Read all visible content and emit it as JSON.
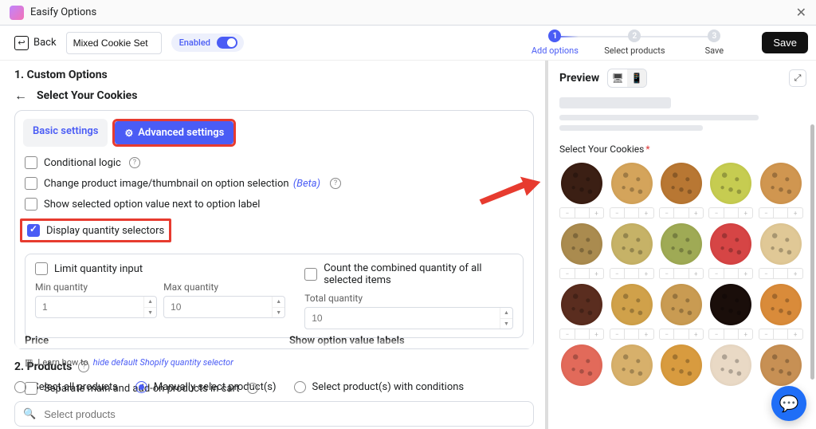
{
  "titlebar": {
    "title": "Easify Options"
  },
  "topbar": {
    "back_label": "Back",
    "title_value": "Mixed Cookie Set",
    "enabled_label": "Enabled",
    "save_label": "Save"
  },
  "stepper": {
    "step1": {
      "num": "1",
      "label": "Add options"
    },
    "step2": {
      "num": "2",
      "label": "Select products"
    },
    "step3": {
      "num": "3",
      "label": "Save"
    }
  },
  "headings": {
    "custom_options": "1. Custom Options",
    "select_cookies": "Select Your Cookies",
    "products": "2. Products"
  },
  "tabs": {
    "basic": "Basic settings",
    "advanced": "Advanced settings"
  },
  "options": {
    "conditional": "Conditional logic",
    "change_image": "Change product image/thumbnail on option selection",
    "beta_tag": "(Beta)",
    "show_selected_value": "Show selected option value next to option label",
    "display_qty": "Display quantity selectors",
    "limit_qty": "Limit quantity input",
    "count_combined": "Count the combined quantity of all selected items",
    "min_qty_label": "Min quantity",
    "max_qty_label": "Max quantity",
    "total_qty_label": "Total quantity",
    "min_qty_ph": "1",
    "max_qty_ph": "10",
    "total_qty_ph": "10",
    "learn_prefix": "Learn how to ",
    "learn_link": "hide default Shopify quantity selector",
    "separate_main": "Separate main and add-on products in cart",
    "price_trunc": "Price",
    "show_labels_trunc": "Show option value labels"
  },
  "products": {
    "select_all": "Select all products",
    "manual": "Manually select product(s)",
    "conditions": "Select product(s) with conditions",
    "search_ph": "Select products"
  },
  "preview": {
    "title": "Preview",
    "section_label": "Select Your Cookies"
  },
  "cookie_colors": [
    "#3b1f14",
    "#d4a45b",
    "#b87733",
    "#c6cc51",
    "#d09650",
    "#aa8b4f",
    "#c6b267",
    "#9faa55",
    "#d64545",
    "#e0c896",
    "#5a2d1f",
    "#d0a14a",
    "#c99b52",
    "#1a0e0a",
    "#d98b3a",
    "#e26a5a",
    "#d7b06b",
    "#d89b3f",
    "#e9d9c5",
    "#c79054"
  ]
}
